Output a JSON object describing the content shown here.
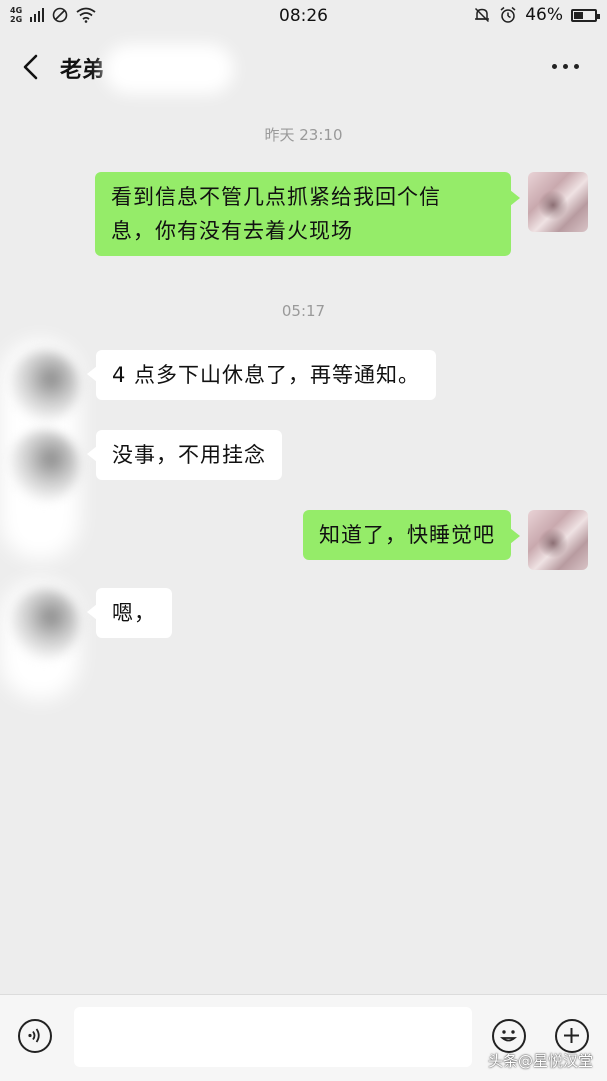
{
  "status_bar": {
    "network_top": "4G",
    "network_bottom": "2G",
    "time": "08:26",
    "battery": "46%",
    "battery_level": 0.46
  },
  "header": {
    "title": "老弟"
  },
  "messages": [
    {
      "type": "time",
      "text": "昨天 23:10"
    },
    {
      "type": "bubble",
      "side": "me",
      "lines": [
        "看到信息不管几点抓紧给我回个信",
        "息，你有没有去着火现场"
      ]
    },
    {
      "type": "time",
      "text": "05:17"
    },
    {
      "type": "bubble",
      "side": "other",
      "text": "4 点多下山休息了，再等通知。"
    },
    {
      "type": "bubble",
      "side": "other",
      "text": "没事，不用挂念"
    },
    {
      "type": "bubble",
      "side": "me",
      "text": "知道了，快睡觉吧"
    },
    {
      "type": "bubble",
      "side": "other",
      "text": "嗯，"
    }
  ],
  "input_bar": {
    "icons": [
      "voice-icon",
      "emoji-icon",
      "plus-icon"
    ]
  },
  "watermark": "头条@星悦汉堂"
}
